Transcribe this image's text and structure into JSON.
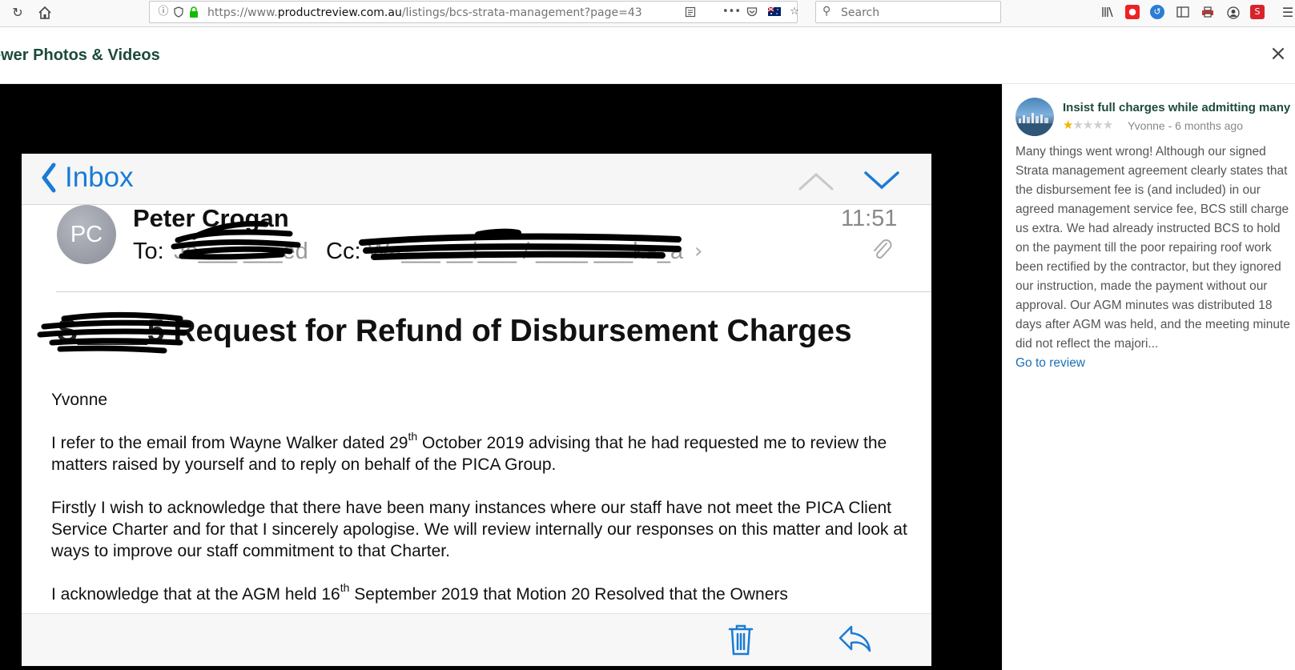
{
  "browser": {
    "url_prefix": "https://www.",
    "url_domain": "productreview.com.au",
    "url_path": "/listings/bcs-strata-management?page=43",
    "search_placeholder": "Search"
  },
  "modal": {
    "title": "ewer Photos & Videos",
    "close_icon": "close-icon"
  },
  "email": {
    "back_label": "Inbox",
    "avatar_initials": "PC",
    "sender": "Peter Crogan",
    "time": "11:51",
    "to_label": "To:",
    "to_name": "Jo___ ___ed",
    "cc_label": "Cc:",
    "cc_names": "Wa___ __l___ / ____ ___ka_a",
    "subject_prefix": "S____5",
    "subject": "Request for Refund of Disbursement Charges",
    "salutation": "Yvonne",
    "p1_a": "I refer to the email from Wayne Walker dated 29",
    "p1_sup": "th",
    "p1_b": " October 2019 advising that he had requested me to review the matters raised by yourself  and to reply on behalf of the PICA Group.",
    "p2": "Firstly I wish to acknowledge that there have been many instances where our staff have not meet the PICA Client Service Charter and for that I sincerely apologise. We will review internally our responses on this matter and look at ways to improve our staff commitment to that Charter.",
    "p3_a": "I acknowledge that at the AGM held 16",
    "p3_sup": "th",
    "p3_b": " September 2019 that Motion 20 Resolved that the Owners"
  },
  "review": {
    "title": "Insist full charges while admitting many",
    "rating": 1,
    "max_rating": 5,
    "author": "Yvonne",
    "meta_sep": " - ",
    "age": "6 months ago",
    "text": "Many things went wrong! Although our signed Strata management agreement clearly states that the disbursement fee is (and included) in our agreed management service fee, BCS still charge us extra. We had already instructed BCS to hold on the payment till the poor repairing roof work been rectified by the contractor, but they ignored our instruction, made the payment without our approval. Our AGM minutes was distributed 18 days after AGM was held, and the meeting minute did not reflect the majori...",
    "link_label": "Go to review"
  },
  "colors": {
    "accent_green": "#1d4b3a",
    "ios_blue": "#1a7bd6",
    "star": "#f5b400",
    "link": "#1a6fb5"
  }
}
